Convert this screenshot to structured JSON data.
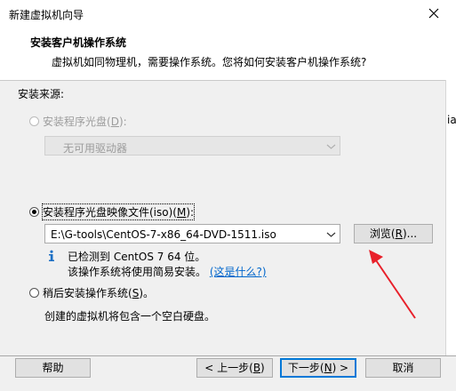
{
  "window": {
    "title": "新建虚拟机向导"
  },
  "header": {
    "title": "安装客户机操作系统",
    "subtitle": "虚拟机如同物理机，需要操作系统。您将如何安装客户机操作系统?"
  },
  "right_fragment": "ia",
  "source": {
    "label": "安装来源:",
    "disc_option": {
      "label": "安装程序光盘",
      "hotkey": "D",
      "prefix": "(",
      "suffix": "):"
    },
    "disc_combo": {
      "value": "无可用驱动器"
    },
    "iso_option": {
      "label": "安装程序光盘映像文件(iso)",
      "hotkey": "M",
      "prefix": "(",
      "suffix": "):"
    },
    "iso_combo": {
      "value": "E:\\G-tools\\CentOS-7-x86_64-DVD-1511.iso"
    },
    "browse_button": {
      "label": "浏览",
      "hotkey": "R",
      "prefix": "(",
      "suffix": ")..."
    },
    "detect_text": "已检测到 CentOS 7 64 位。",
    "easy_install_text": "该操作系统将使用简易安装。",
    "whats_this_link": "(这是什么?)",
    "later_option": {
      "label": "稍后安装操作系统",
      "hotkey": "S",
      "prefix": "(",
      "suffix": ")。"
    },
    "later_desc": "创建的虚拟机将包含一个空白硬盘。"
  },
  "footer": {
    "help": "帮助",
    "back": {
      "label": "< 上一步",
      "hotkey": "B",
      "prefix": "(",
      "suffix": ")"
    },
    "next": {
      "label": "下一步",
      "hotkey": "N",
      "prefix": "(",
      "suffix": ") >"
    },
    "cancel": "取消"
  },
  "colors": {
    "annotation_arrow": "#e8202a",
    "link": "#0066cc",
    "focus_border": "#0078d7"
  }
}
